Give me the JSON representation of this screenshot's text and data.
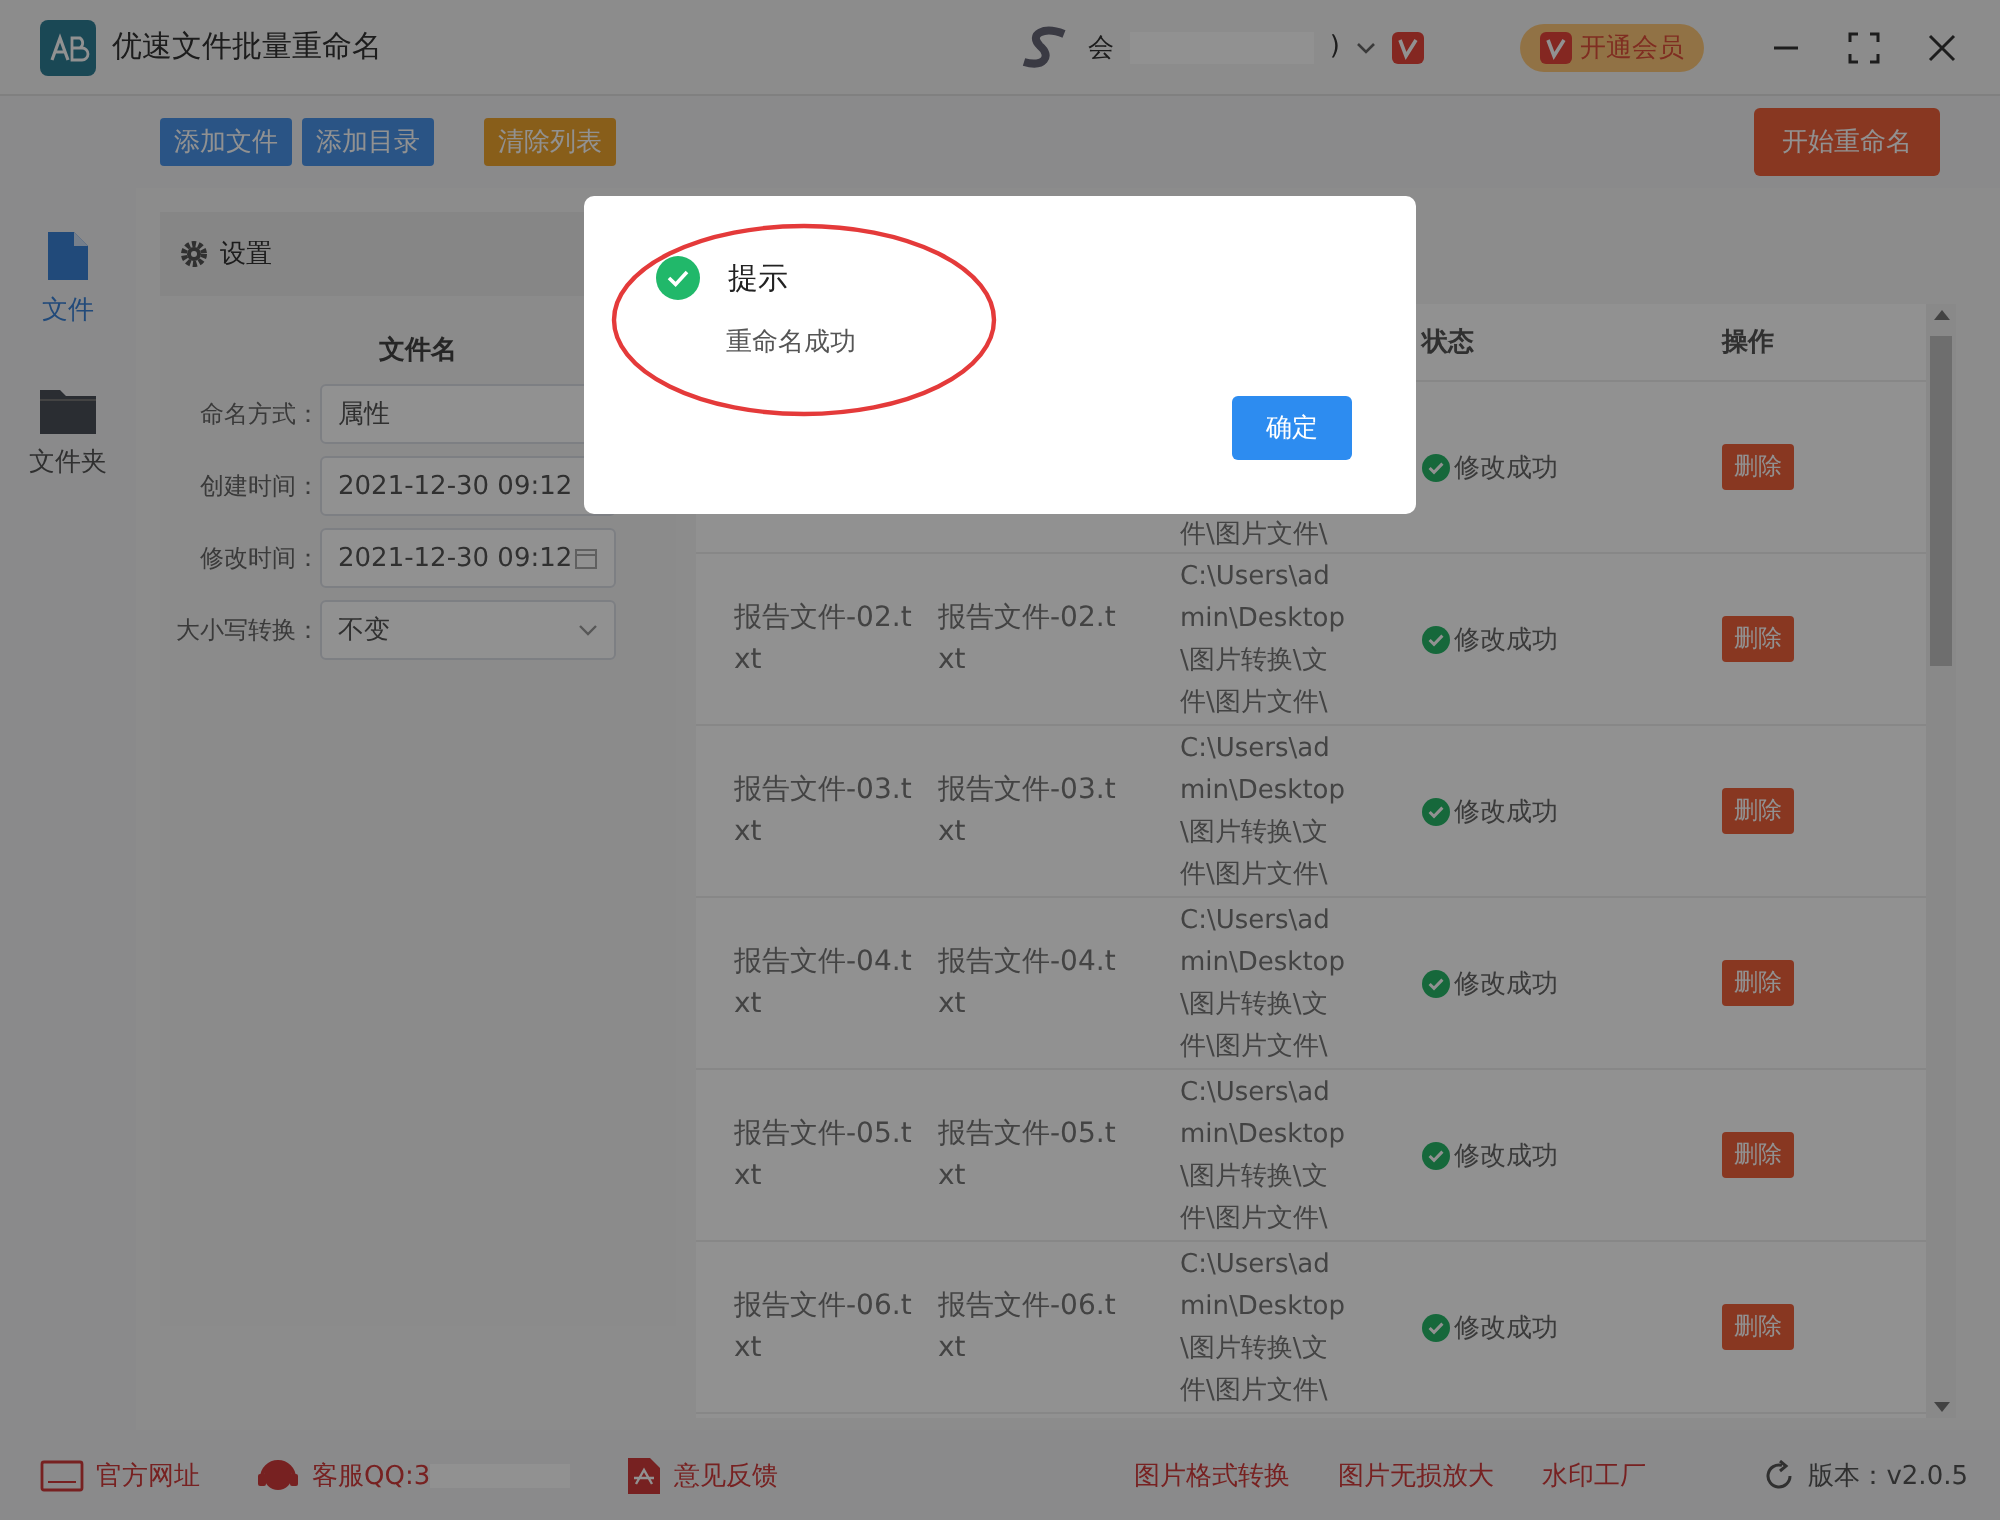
{
  "window": {
    "title": "优速文件批量重命名",
    "user_prefix": "会",
    "user_suffix": ")",
    "vip_button": "开通会员"
  },
  "toolbar": {
    "buttons": [
      {
        "label": "添加文件",
        "kind": "primary"
      },
      {
        "label": "添加目录",
        "kind": "primary"
      },
      {
        "label": "清除列表",
        "kind": "warning"
      }
    ],
    "start_button": "开始重命名"
  },
  "sidebar": {
    "items": [
      {
        "label": "文件",
        "kind": "file",
        "selected": true
      },
      {
        "label": "文件夹",
        "kind": "folder",
        "selected": false
      }
    ]
  },
  "settings": {
    "title": "设置",
    "section": "文件名",
    "fields": [
      {
        "label": "命名方式：",
        "value": "属性",
        "kind": "text"
      },
      {
        "label": "创建时间：",
        "value": "2021-12-30 09:12",
        "kind": "text"
      },
      {
        "label": "修改时间：",
        "value": "2021-12-30 09:12",
        "kind": "date"
      },
      {
        "label": "大小写转换：",
        "value": "不变",
        "kind": "select"
      }
    ]
  },
  "table": {
    "columns": [
      {
        "label": "状态"
      },
      {
        "label": "操作"
      }
    ],
    "rows": [
      {
        "path": "件\\图片文件\\",
        "status": "修改成功",
        "action": "删除"
      },
      {
        "original": "报告文件-02.txt",
        "new": "报告文件-02.txt",
        "path": "C:\\Users\\admin\\Desktop\\图片转换\\文件\\图片文件\\",
        "status": "修改成功",
        "action": "删除"
      },
      {
        "original": "报告文件-03.txt",
        "new": "报告文件-03.txt",
        "path": "C:\\Users\\admin\\Desktop\\图片转换\\文件\\图片文件\\",
        "status": "修改成功",
        "action": "删除"
      },
      {
        "original": "报告文件-04.txt",
        "new": "报告文件-04.txt",
        "path": "C:\\Users\\admin\\Desktop\\图片转换\\文件\\图片文件\\",
        "status": "修改成功",
        "action": "删除"
      },
      {
        "original": "报告文件-05.txt",
        "new": "报告文件-05.txt",
        "path": "C:\\Users\\admin\\Desktop\\图片转换\\文件\\图片文件\\",
        "status": "修改成功",
        "action": "删除"
      },
      {
        "original": "报告文件-06.txt",
        "new": "报告文件-06.txt",
        "path": "C:\\Users\\admin\\Desktop\\图片转换\\文件\\图片文件\\",
        "status": "修改成功",
        "action": "删除"
      }
    ]
  },
  "footer": {
    "links": [
      {
        "label": "官方网址",
        "kind": "web"
      },
      {
        "label": "客服QQ:3",
        "kind": "support"
      },
      {
        "label": "意见反馈",
        "kind": "feedback"
      }
    ],
    "tools": [
      "图片格式转换",
      "图片无损放大",
      "水印工厂"
    ],
    "version": "版本：v2.0.5"
  },
  "dialog": {
    "title": "提示",
    "message": "重命名成功",
    "button": "确定"
  }
}
